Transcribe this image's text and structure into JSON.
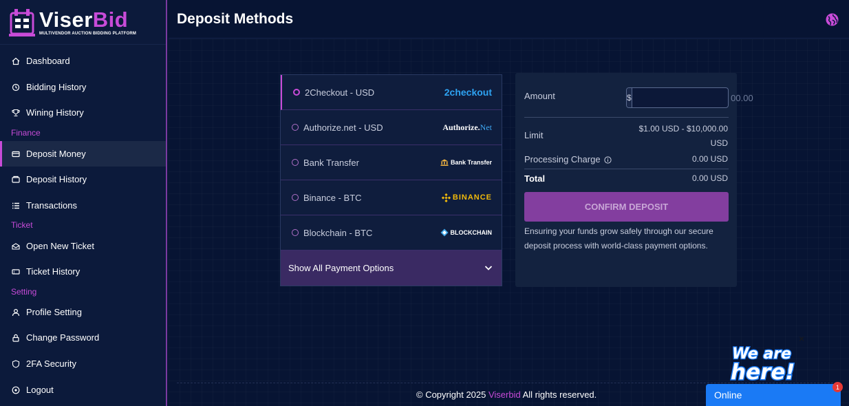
{
  "brand": {
    "name_part1": "Viser",
    "name_part2": "Bid",
    "tagline": "MULTIVENDOR AUCTION BIDDING PLATFORM"
  },
  "sidebar": {
    "items": [
      {
        "label": "Dashboard",
        "icon": "home-icon"
      },
      {
        "label": "Bidding History",
        "icon": "history-icon"
      },
      {
        "label": "Wining History",
        "icon": "trophy-icon"
      },
      {
        "label": "Deposit Money",
        "icon": "wallet-icon",
        "active": true
      },
      {
        "label": "Deposit History",
        "icon": "deposit-history-icon"
      },
      {
        "label": "Transactions",
        "icon": "list-icon"
      },
      {
        "label": "Open New Ticket",
        "icon": "ticket-open-icon"
      },
      {
        "label": "Ticket History",
        "icon": "ticket-icon"
      },
      {
        "label": "Profile Setting",
        "icon": "user-icon"
      },
      {
        "label": "Change Password",
        "icon": "lock-icon"
      },
      {
        "label": "2FA Security",
        "icon": "shield-icon"
      },
      {
        "label": "Logout",
        "icon": "logout-icon"
      }
    ],
    "sections": {
      "finance": "Finance",
      "ticket": "Ticket",
      "setting": "Setting"
    }
  },
  "header": {
    "title": "Deposit Methods"
  },
  "methods": {
    "items": [
      {
        "label": "2Checkout - USD",
        "logo_text": "2checkout",
        "selected": true
      },
      {
        "label": "Authorize.net - USD",
        "logo_text_a": "Authorize.",
        "logo_text_b": "Net"
      },
      {
        "label": "Bank Transfer",
        "logo_text": "Bank Transfer"
      },
      {
        "label": "Binance - BTC",
        "logo_text": "BINANCE"
      },
      {
        "label": "Blockchain - BTC",
        "logo_text": "BLOCKCHAIN"
      }
    ],
    "show_all_label": "Show All Payment Options"
  },
  "summary": {
    "amount_label": "Amount",
    "currency_symbol": "$",
    "amount_placeholder": "00.00",
    "limit_label": "Limit",
    "limit_value_line1": "$1.00 USD - $10,000.00",
    "limit_value_line2": "USD",
    "charge_label": "Processing Charge",
    "charge_value": "0.00 USD",
    "total_label": "Total",
    "total_value": "0.00 USD",
    "confirm_label": "CONFIRM DEPOSIT",
    "note": "Ensuring your funds grow safely through our secure deposit process with world-class payment options."
  },
  "footer": {
    "prefix": "© Copyright 2025",
    "brand": "Viserbid",
    "suffix": "All rights reserved."
  },
  "chat": {
    "banner_text": "We are here!",
    "close_glyph": "×",
    "status": "Online",
    "badge_count": "1"
  },
  "colors": {
    "accent": "#c84bd8",
    "background": "#071433",
    "sidebar": "#0c1a3b",
    "confirm": "#833e9f",
    "chat": "#1a7af5"
  }
}
